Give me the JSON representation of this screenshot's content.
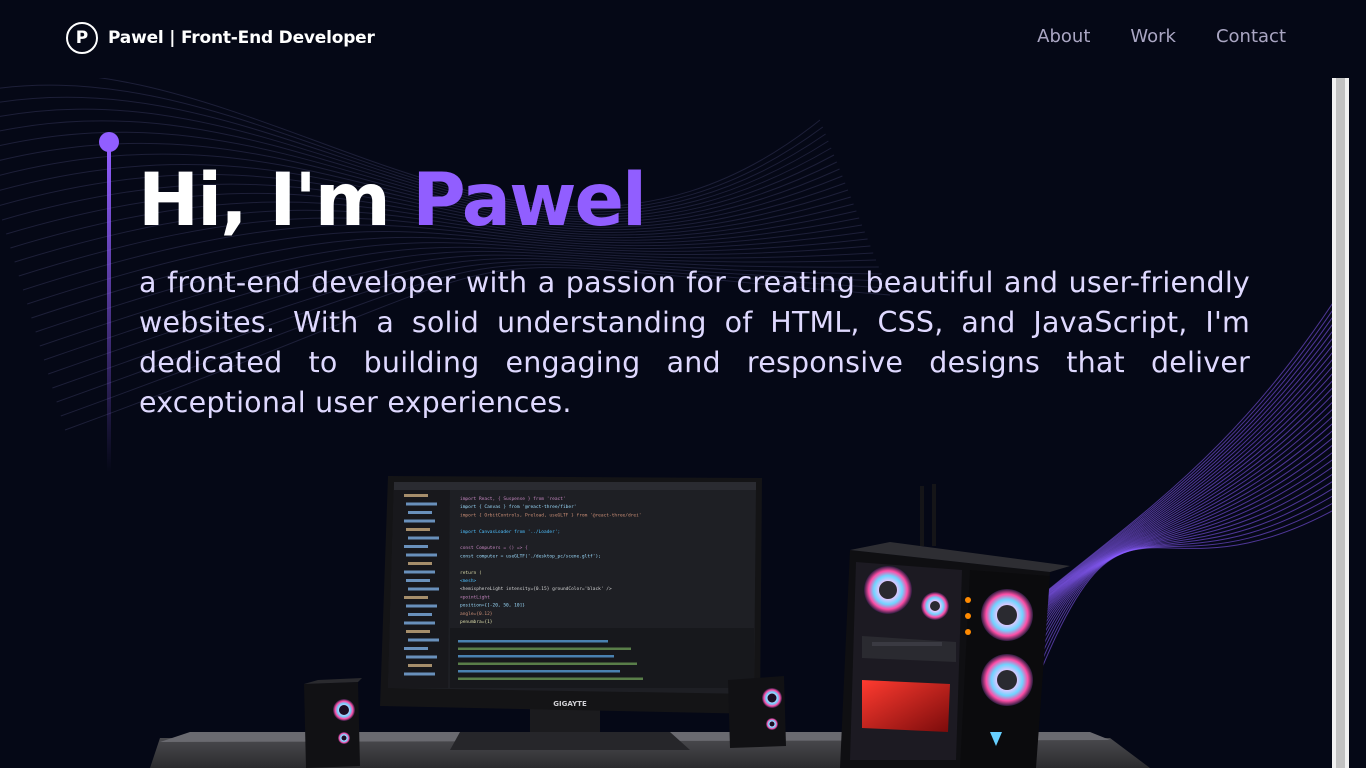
{
  "navbar": {
    "logo_letter": "P",
    "brand_title": "Pawel | Front-End Developer",
    "links": [
      {
        "label": "About"
      },
      {
        "label": "Work"
      },
      {
        "label": "Contact"
      }
    ]
  },
  "hero": {
    "greeting": "Hi, I'm",
    "name": "Pawel",
    "subtitle": "a front-end developer with a passion for creating beautiful and user-friendly websites. With a solid understanding of HTML, CSS, and JavaScript, I'm dedicated to building engaging and responsive designs that deliver exceptional user experiences."
  },
  "scene": {
    "monitor_brand": "GIGAYTE",
    "code_lines": [
      "import React, { Suspense } from 'react'",
      "import { Canvas } from '@react-three/fiber'",
      "import { OrbitControls, Preload, useGLTF } from '@react-three/drei'",
      "",
      "import CanvasLoader from '../Loader';",
      "",
      "const Computers = () => {",
      "  const computer = useGLTF('./desktop_pc/scene.gltf');",
      "",
      "  return (",
      "    <mesh>",
      "      <hemisphereLight intensity={0.15} groundColor='black' />",
      "      <pointLight",
      "        position={[-20, 50, 10]}",
      "        angle={0.12}",
      "        penumbra={1}"
    ]
  },
  "colors": {
    "background": "#050816",
    "accent": "#915eff",
    "nav_text": "#aaa6c3",
    "subtitle_text": "#dfd9ff"
  }
}
